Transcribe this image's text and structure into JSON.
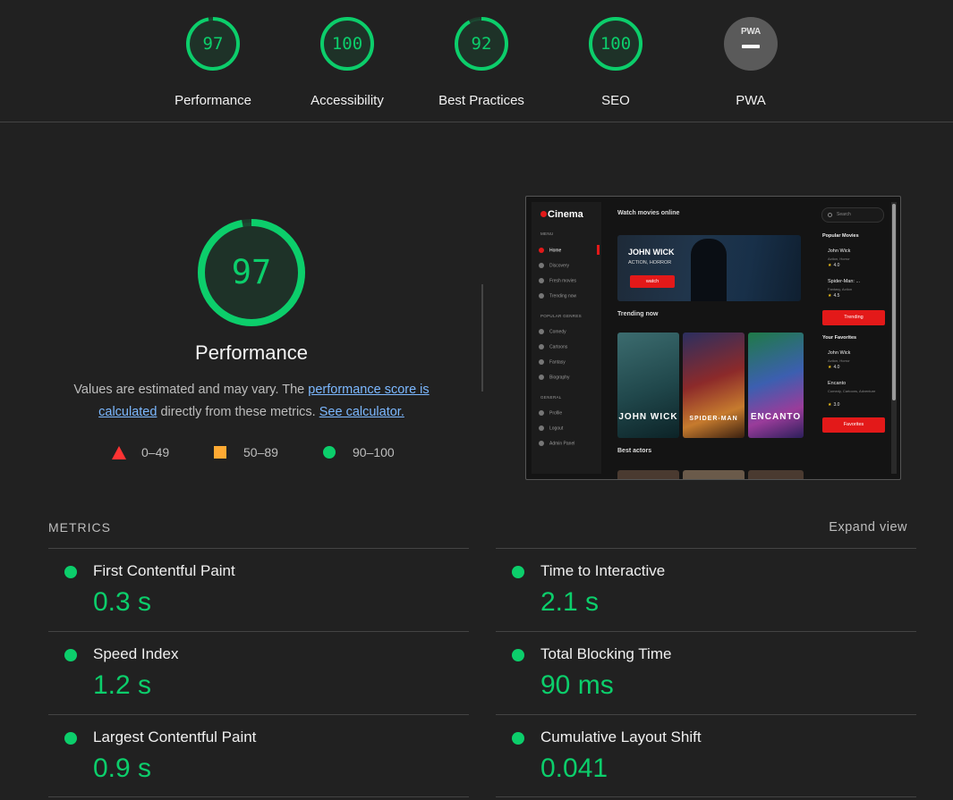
{
  "categories": [
    {
      "label": "Performance",
      "score": "97",
      "fraction": 0.97
    },
    {
      "label": "Accessibility",
      "score": "100",
      "fraction": 1.0
    },
    {
      "label": "Best Practices",
      "score": "92",
      "fraction": 0.92
    },
    {
      "label": "SEO",
      "score": "100",
      "fraction": 1.0
    }
  ],
  "pwa": {
    "label": "PWA",
    "badge_text": "PWA"
  },
  "main_gauge": {
    "score": "97",
    "fraction": 0.97,
    "title": "Performance"
  },
  "description": {
    "text1": "Values are estimated and may vary. The ",
    "link1": "performance score is calculated",
    "text2": " directly from these metrics. ",
    "link2": "See calculator."
  },
  "legend": [
    {
      "label": "0–49",
      "color": "#ff3333",
      "shape": "triangle"
    },
    {
      "label": "50–89",
      "color": "#ffaa33",
      "shape": "square"
    },
    {
      "label": "90–100",
      "color": "#0cce6b",
      "shape": "circle"
    }
  ],
  "metrics": {
    "header": "METRICS",
    "expand_label": "Expand view",
    "left": [
      {
        "name": "First Contentful Paint",
        "value": "0.3 s"
      },
      {
        "name": "Speed Index",
        "value": "1.2 s"
      },
      {
        "name": "Largest Contentful Paint",
        "value": "0.9 s"
      }
    ],
    "right": [
      {
        "name": "Time to Interactive",
        "value": "2.1 s"
      },
      {
        "name": "Total Blocking Time",
        "value": "90 ms"
      },
      {
        "name": "Cumulative Layout Shift",
        "value": "0.041"
      }
    ]
  },
  "preview": {
    "logo": "Cinema",
    "menu_label": "MENU",
    "menu": [
      "Home",
      "Discovery",
      "Fresh movies",
      "Trending now"
    ],
    "genres_label": "POPULAR GENRES",
    "genres": [
      "Comedy",
      "Cartoons",
      "Fantasy",
      "Biography"
    ],
    "general_label": "GENERAL",
    "general": [
      "Profile",
      "Logout",
      "Admin Panel"
    ],
    "heading": "Watch movies online",
    "hero_title": "JOHN WICK",
    "hero_sub": "ACTION, HORROR",
    "hero_button": "watch",
    "trending_heading": "Trending now",
    "poster_titles": [
      "JOHN WICK",
      "SPIDER-MAN",
      "ENCANTO"
    ],
    "actors_heading": "Best actors",
    "search_placeholder": "Search",
    "popular_heading": "Popular Movies",
    "popular": [
      {
        "title": "John Wick",
        "genres": "Action, Horror",
        "rating": "4.0"
      },
      {
        "title": "Spider-Man: ...",
        "genres": "Fantasy, Action",
        "rating": "4.5"
      }
    ],
    "trending_button": "Trending",
    "favorites_heading": "Your Favorites",
    "favorites": [
      {
        "title": "John Wick",
        "genres": "Action, Horror",
        "rating": "4.0"
      },
      {
        "title": "Encanto",
        "genres": "Comedy, Cartoons, Adventure",
        "rating": "3.0"
      }
    ],
    "favorites_button": "Favorites"
  },
  "colors": {
    "pass": "#0cce6b",
    "average": "#ffaa33",
    "fail": "#ff3333",
    "background": "#212121",
    "accent_red": "#e31919"
  }
}
